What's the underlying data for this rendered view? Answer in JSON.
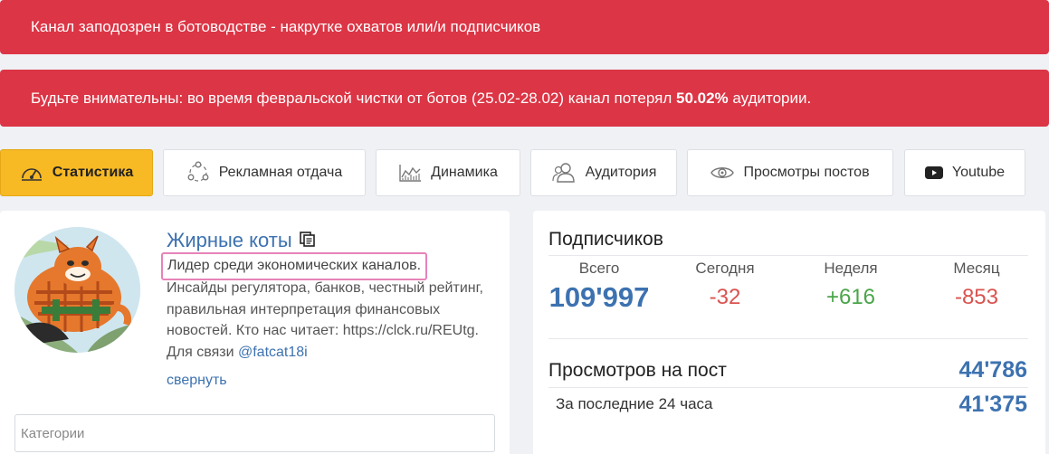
{
  "alerts": {
    "bot_warning": "Канал заподозрен в ботоводстве - накрутке охватов или/и подписчиков",
    "purge_prefix": "Будьте внимательны: во время февральской чистки от ботов (25.02-28.02) канал потерял ",
    "purge_percent": "50.02%",
    "purge_suffix": " аудитории."
  },
  "tabs": [
    {
      "label": "Статистика",
      "icon": "speedometer-icon",
      "active": true
    },
    {
      "label": "Рекламная отдача",
      "icon": "network-icon"
    },
    {
      "label": "Динамика",
      "icon": "chart-icon"
    },
    {
      "label": "Аудитория",
      "icon": "users-icon"
    },
    {
      "label": "Просмотры постов",
      "icon": "eye-icon"
    },
    {
      "label": "Youtube",
      "icon": "youtube-icon"
    }
  ],
  "channel": {
    "title": "Жирные коты",
    "copy_icon": "copy-icon",
    "description_highlight": "Лидер среди экономических каналов.",
    "description": "Инсайды регулятора, банков, честный рейтинг, правильная интерпретация финансовых новостей. Кто нас читает: https://clck.ru/REUtg. Для связи ",
    "contact_link": "@fatcat18i",
    "collapse_label": "свернуть",
    "categories_placeholder": "Категории"
  },
  "subscribers": {
    "title": "Подписчиков",
    "total_label": "Всего",
    "total_value": "109'997",
    "today_label": "Сегодня",
    "today_value": "-32",
    "week_label": "Неделя",
    "week_value": "+616",
    "month_label": "Месяц",
    "month_value": "-853"
  },
  "views": {
    "per_post_label": "Просмотров на пост",
    "per_post_value": "44'786",
    "last24_label": "За последние 24 часа",
    "last24_value": "41'375"
  },
  "colors": {
    "alert": "#dc3545",
    "active_tab": "#f7b924",
    "link": "#3d72b0",
    "negative": "#d9534f",
    "positive": "#4aa54a",
    "highlight_border": "#e683b9"
  }
}
